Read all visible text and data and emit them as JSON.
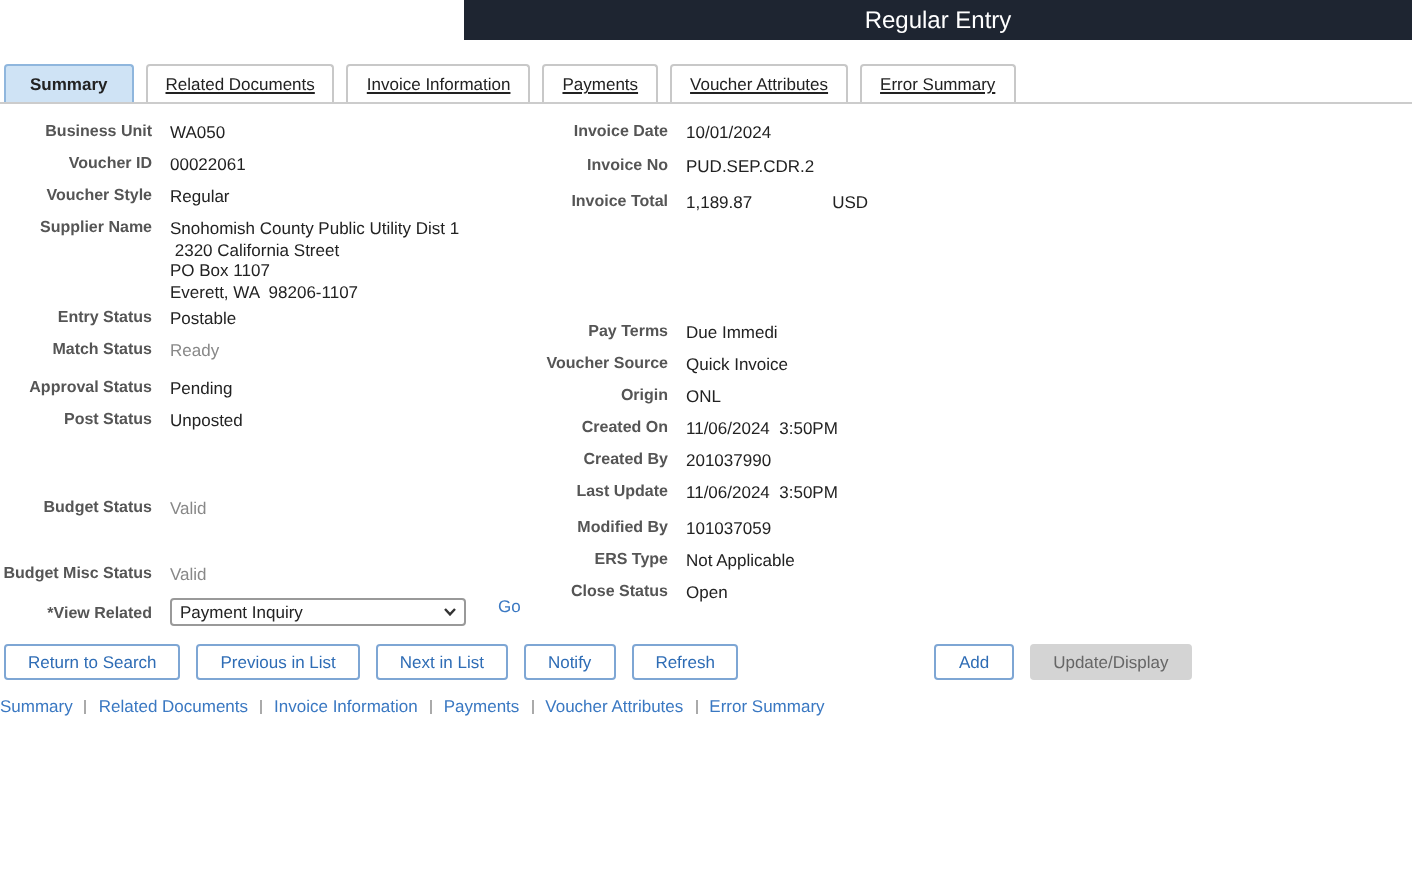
{
  "window": {
    "title": "Regular Entry"
  },
  "tabs": [
    {
      "label": "Summary",
      "selected": true
    },
    {
      "label": "Related Documents",
      "selected": false
    },
    {
      "label": "Invoice Information",
      "selected": false
    },
    {
      "label": "Payments",
      "selected": false
    },
    {
      "label": "Voucher Attributes",
      "selected": false
    },
    {
      "label": "Error Summary",
      "selected": false
    }
  ],
  "left_fields": [
    {
      "label": "Business Unit",
      "value": [
        "WA050"
      ]
    },
    {
      "label": "Voucher ID",
      "value": [
        "00022061"
      ]
    },
    {
      "label": "Voucher Style",
      "value": [
        "Regular"
      ]
    },
    {
      "label": "Supplier Name",
      "value": [
        "Snohomish County Public Utility Dist 1",
        " 2320 California Street",
        "PO Box 1107",
        "Everett, WA  98206-1107"
      ]
    },
    {
      "label": "Entry Status",
      "value": [
        "Postable"
      ]
    },
    {
      "label": "Match Status",
      "value": [
        "Ready"
      ],
      "disabled": true
    },
    {
      "label": "Approval Status",
      "value": [
        "Pending"
      ]
    },
    {
      "label": "Post Status",
      "value": [
        "Unposted"
      ]
    },
    {
      "label": "Budget Status",
      "value": [
        "Valid"
      ],
      "disabled": true
    },
    {
      "label": "Budget Misc Status",
      "value": [
        "Valid"
      ],
      "disabled": true
    }
  ],
  "right_fields": [
    {
      "label": "Invoice Date",
      "value": [
        "10/01/2024"
      ]
    },
    {
      "label": "Invoice No",
      "value": [
        "PUD.SEP.CDR.2"
      ]
    },
    {
      "label": "Invoice Total",
      "value": [
        "1,189.87"
      ],
      "currency": "USD"
    },
    {
      "label": "Pay Terms",
      "value": [
        "Due Immedi"
      ]
    },
    {
      "label": "Voucher Source",
      "value": [
        "Quick Invoice"
      ]
    },
    {
      "label": "Origin",
      "value": [
        "ONL"
      ]
    },
    {
      "label": "Created On",
      "value": [
        "11/06/2024  3:50PM"
      ]
    },
    {
      "label": "Created By",
      "value": [
        "201037990"
      ]
    },
    {
      "label": "Last Update",
      "value": [
        "11/06/2024  3:50PM"
      ]
    },
    {
      "label": "Modified By",
      "value": [
        "101037059"
      ]
    },
    {
      "label": "ERS Type",
      "value": [
        "Not Applicable"
      ]
    },
    {
      "label": "Close Status",
      "value": [
        "Open"
      ]
    }
  ],
  "view_related": {
    "label": "*View Related",
    "value": "Payment Inquiry",
    "go": "Go"
  },
  "buttons": [
    {
      "label": "Return to Search",
      "disabled": false
    },
    {
      "label": "Previous in List",
      "disabled": false
    },
    {
      "label": "Next in List",
      "disabled": false
    },
    {
      "label": "Notify",
      "disabled": false
    },
    {
      "label": "Refresh",
      "disabled": false
    },
    {
      "label": "Add",
      "disabled": false
    },
    {
      "label": "Update/Display",
      "disabled": true
    }
  ],
  "footer_links": [
    "Summary",
    "Related Documents",
    "Invoice Information",
    "Payments",
    "Voucher Attributes",
    "Error Summary"
  ]
}
